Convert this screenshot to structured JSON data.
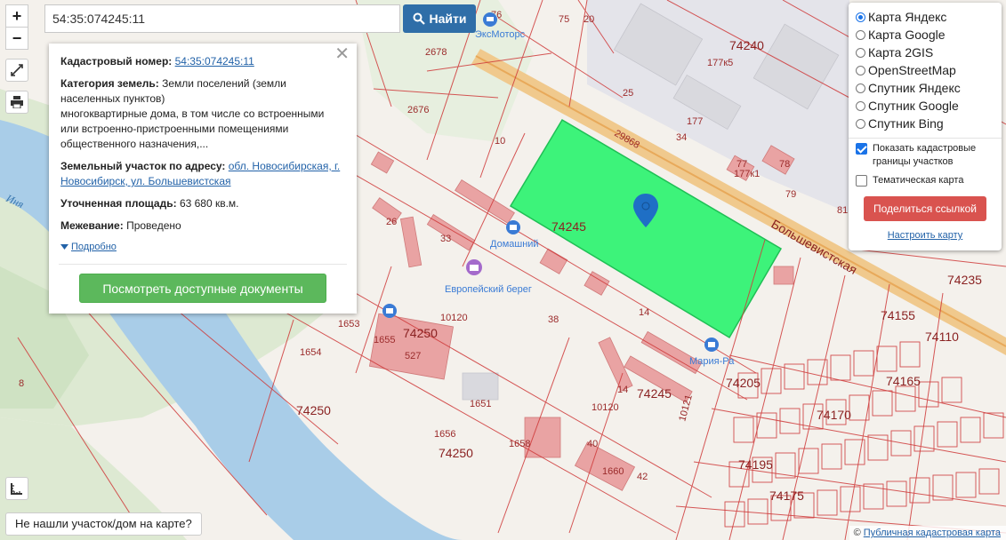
{
  "search": {
    "value": "54:35:074245:11",
    "button_label": "Найти"
  },
  "zoom": {
    "in_label": "+",
    "out_label": "−"
  },
  "info_panel": {
    "close_label": "✕",
    "cadastral_label": "Кадастровый номер:",
    "cadastral_value": "54:35:074245:11",
    "category_label": "Категория земель:",
    "category_value": "Земли поселений (земли населенных пунктов)",
    "usage_text": "многоквартирные дома, в том числе со встроенными или встроенно-пристроенными помещениями общественного назначения,...",
    "address_label": "Земельный участок по адресу:",
    "address_value": "обл. Новосибирская, г. Новосибирск, ул. Большевистская",
    "area_label": "Уточненная площадь:",
    "area_value": "63 680 кв.м.",
    "survey_label": "Межевание:",
    "survey_value": "Проведено",
    "details_link": "Подробно",
    "docs_button": "Посмотреть доступные документы"
  },
  "layers_panel": {
    "options": [
      {
        "label": "Карта Яндекс",
        "selected": true
      },
      {
        "label": "Карта Google",
        "selected": false
      },
      {
        "label": "Карта 2GIS",
        "selected": false
      },
      {
        "label": "OpenStreetMap",
        "selected": false
      },
      {
        "label": "Спутник Яндекс",
        "selected": false
      },
      {
        "label": "Спутник Google",
        "selected": false
      },
      {
        "label": "Спутник Bing",
        "selected": false
      }
    ],
    "show_borders_label": "Показать кадастровые границы участков",
    "show_borders_checked": true,
    "thematic_label": "Тематическая карта",
    "thematic_checked": false,
    "share_button": "Поделиться ссылкой",
    "setup_link": "Настроить карту"
  },
  "not_found_button": "Не нашли участок/дом на карте?",
  "attribution": {
    "symbol": "©",
    "link": "Публичная кадастровая карта"
  },
  "map_labels": {
    "quarter_74240": "74240",
    "quarter_74245_top": "74245",
    "quarter_74245_bottom": "74245",
    "quarter_74250_a": "74250",
    "quarter_74250_b": "74250",
    "quarter_74250_c": "74250",
    "quarter_74205": "74205",
    "quarter_74110": "74110",
    "quarter_74235": "74235",
    "quarter_74170": "74170",
    "quarter_74175": "74175",
    "quarter_74165": "74165",
    "quarter_74155": "74155",
    "quarter_74195": "74195",
    "poi_domashny": "Домашний",
    "poi_evropeisky": "Европейский берег",
    "poi_maria": "Мария-Ра",
    "poi_motors": "ЭксМоторс",
    "river_name": "Иня",
    "street_bolshevistskaya": "Большевистская",
    "street_29868": "29868",
    "n_10": "10",
    "n_2676": "2676",
    "n_2678": "2678",
    "n_33": "33",
    "n_26": "26",
    "n_38": "38",
    "n_14a": "14",
    "n_14b": "14",
    "n_1651": "1651",
    "n_1653": "1653",
    "n_1654": "1654",
    "n_1655": "1655",
    "n_527": "527",
    "n_1656": "1656",
    "n_1658": "1658",
    "n_1660": "1660",
    "n_42": "42",
    "n_40": "40",
    "n_8": "8",
    "n_177": "177",
    "n_177k5": "177к5",
    "n_177k1": "177к1",
    "n_76": "76",
    "n_78": "78",
    "n_79": "79",
    "n_81": "81",
    "n_34": "34",
    "n_25": "25",
    "n_20": "20",
    "n_75": "75",
    "n_77": "77",
    "n_10120": "10120",
    "n_10121": "10121"
  }
}
